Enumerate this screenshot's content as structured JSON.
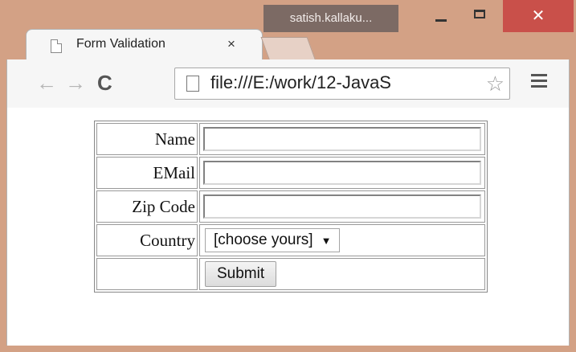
{
  "window": {
    "user": "satish.kallaku...",
    "minimize_icon": "minimize-icon",
    "maximize_icon": "maximize-icon",
    "close_label": "✕"
  },
  "tab": {
    "title": "Form Validation",
    "close_label": "×"
  },
  "toolbar": {
    "back": "←",
    "forward": "→",
    "reload": "C",
    "url": "file:///E:/work/12-JavaS",
    "star": "☆"
  },
  "form": {
    "name_label": "Name",
    "email_label": "EMail",
    "zip_label": "Zip Code",
    "country_label": "Country",
    "country_selected": "[choose yours]",
    "caret": "▼",
    "submit_label": "Submit"
  },
  "colors": {
    "frame": "#d3a185",
    "close_button": "#c9504a",
    "user_badge": "#7c6a64"
  }
}
